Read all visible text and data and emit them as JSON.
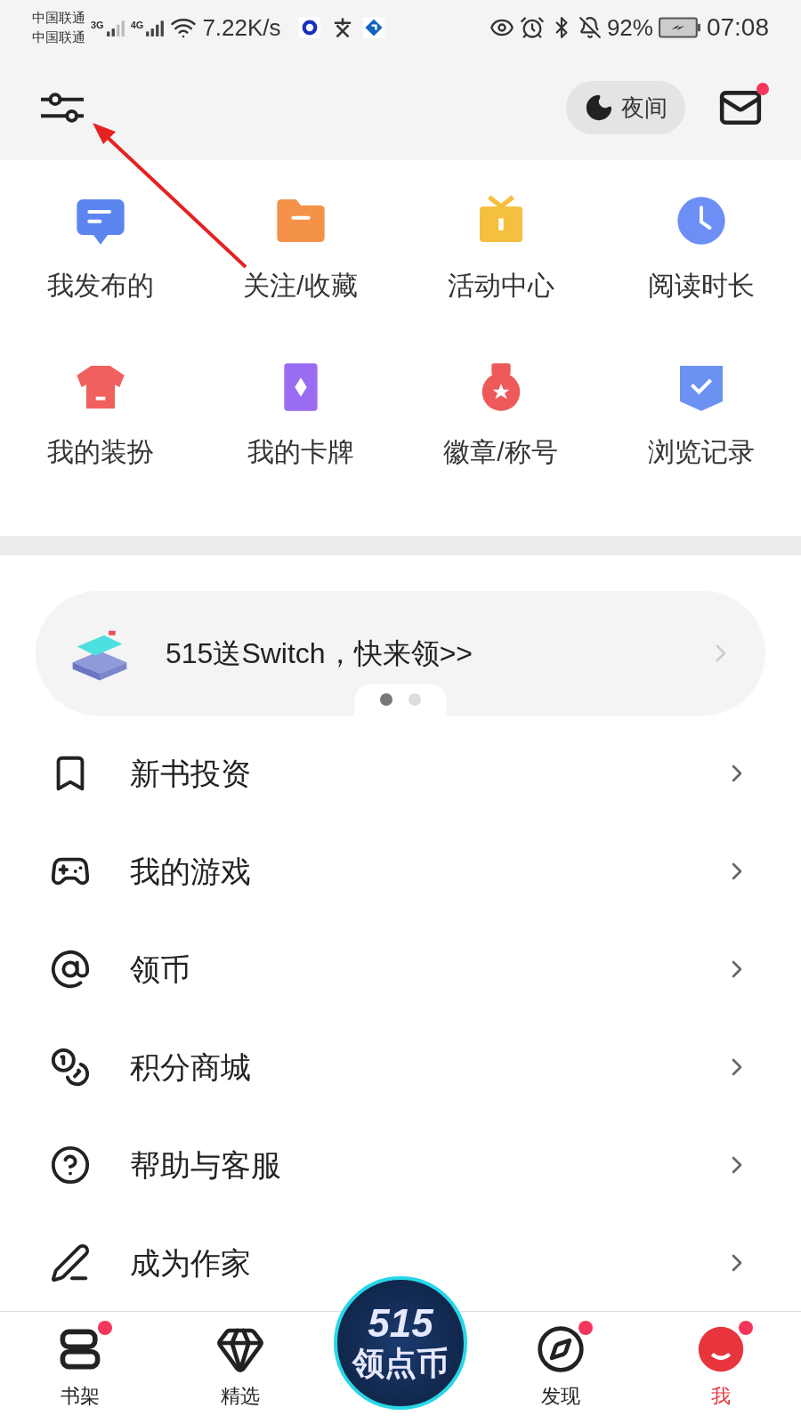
{
  "status_bar": {
    "carriers": [
      "中国联通",
      "中国联通"
    ],
    "networks": [
      "3G",
      "4G"
    ],
    "speed": "7.22K/s",
    "battery": "92%",
    "time": "07:08"
  },
  "header": {
    "night_mode": "夜间",
    "mail_badge": true
  },
  "grid": [
    {
      "label": "我发布的",
      "color": "#5b86f0"
    },
    {
      "label": "关注/收藏",
      "color": "#f5924a"
    },
    {
      "label": "活动中心",
      "color": "#f5c040"
    },
    {
      "label": "阅读时长",
      "color": "#6d8ff5"
    },
    {
      "label": "我的装扮",
      "color": "#f0605e"
    },
    {
      "label": "我的卡牌",
      "color": "#9a6cf2"
    },
    {
      "label": "徽章/称号",
      "color": "#ee5a5a"
    },
    {
      "label": "浏览记录",
      "color": "#6b92f2"
    }
  ],
  "banner": {
    "text": "515送Switch，快来领>>",
    "dots": [
      {
        "selected": true
      },
      {
        "selected": false
      }
    ]
  },
  "menu": [
    {
      "label": "新书投资"
    },
    {
      "label": "我的游戏"
    },
    {
      "label": "领币"
    },
    {
      "label": "积分商城"
    },
    {
      "label": "帮助与客服"
    },
    {
      "label": "成为作家"
    }
  ],
  "bottom_nav": [
    {
      "kind": "tab",
      "label": "书架",
      "selected": false,
      "badge": true
    },
    {
      "kind": "tab",
      "label": "精选",
      "selected": false,
      "badge": false
    },
    {
      "kind": "promo",
      "label": "515",
      "sublabel": "领点币"
    },
    {
      "kind": "tab",
      "label": "发现",
      "selected": false,
      "badge": true
    },
    {
      "kind": "tab",
      "label": "我",
      "selected": true,
      "badge": true
    }
  ]
}
